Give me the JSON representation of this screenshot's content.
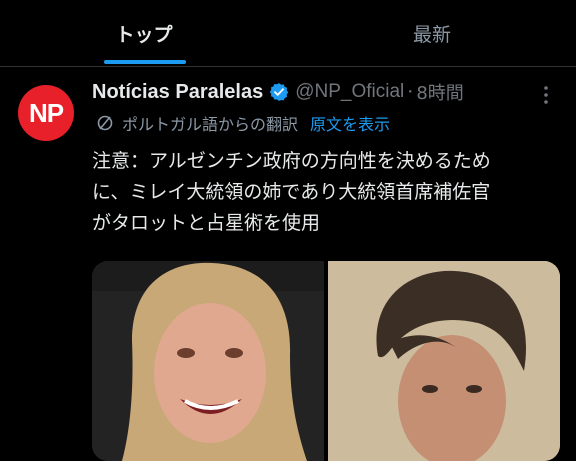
{
  "tabs": [
    {
      "label": "トップ",
      "active": true
    },
    {
      "label": "最新",
      "active": false
    }
  ],
  "colors": {
    "accent": "#1d9bf0",
    "avatar_bg": "#e8202a",
    "background": "#000000"
  },
  "post": {
    "avatar_text": "NP",
    "author_name": "Notícias Paralelas",
    "handle": "@NP_Oficial",
    "separator": "·",
    "time": "8時間",
    "translation_note": "ポルトガル語からの翻訳",
    "show_original_label": "原文を表示",
    "body_lines": [
      "注意：アルゼンチン政府の方向性を決めるため",
      "に、ミレイ大統領の姉であり大統領首席補佐官",
      "がタロットと占星術を使用"
    ]
  },
  "icons": {
    "verified": "verified-badge-icon",
    "more": "more-options-icon",
    "translate": "translate-globe-icon"
  }
}
